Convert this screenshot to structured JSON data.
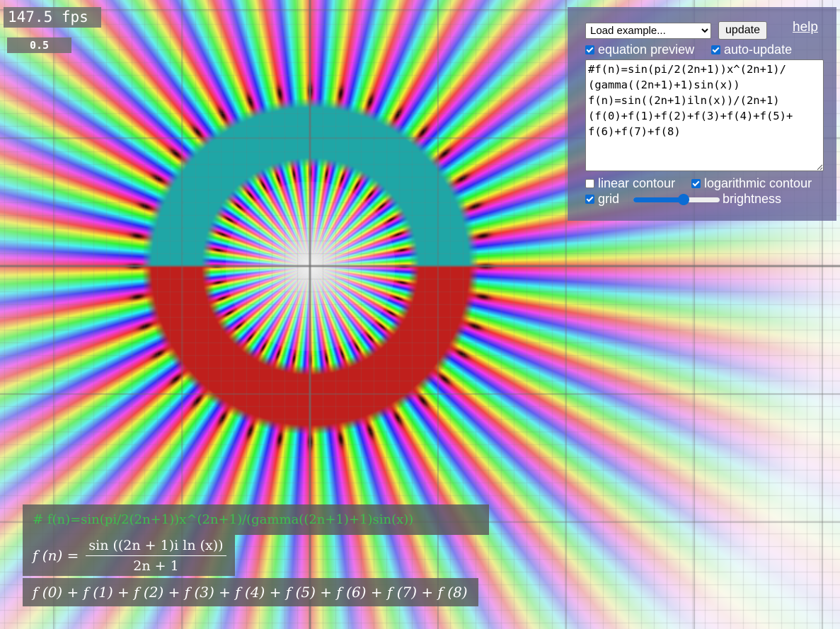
{
  "readouts": {
    "fps": "147.5 fps",
    "zoom": "0.5"
  },
  "panel": {
    "example_select": "Load example...",
    "update_label": "update",
    "help_label": "help",
    "equation_preview_label": "equation preview",
    "equation_preview_checked": true,
    "auto_update_label": "auto-update",
    "auto_update_checked": true,
    "code": "#f(n)=sin(pi/2(2n+1))x^(2n+1)/\n(gamma((2n+1)+1)sin(x))\nf(n)=sin((2n+1)iln(x))/(2n+1)\n(f(0)+f(1)+f(2)+f(3)+f(4)+f(5)+\nf(6)+f(7)+f(8)",
    "linear_contour_label": "linear contour",
    "linear_contour_checked": false,
    "log_contour_label": "logarithmic contour",
    "log_contour_checked": true,
    "grid_label": "grid",
    "grid_checked": true,
    "brightness_label": "brightness",
    "brightness_value": 0.58,
    "accent_color": "#0b6cd4"
  },
  "preview": {
    "comment": "# f(n)=sin(pi/2(2n+1))x^(2n+1)/(gamma((2n+1)+1)sin(x))",
    "lhs": "f (n) =",
    "numerator": "sin ((2n + 1)i ln (x))",
    "denominator": "2n + 1",
    "sum": "f (0) + f (1) + f (2) + f (3) + f (4) + f (5) + f (6) + f (7) + f (8)",
    "comment_color": "#3dbf4e"
  },
  "plot": {
    "description_colors": {
      "upper_ring": "#1fa6a6",
      "lower_ring": "#c0201c"
    }
  }
}
